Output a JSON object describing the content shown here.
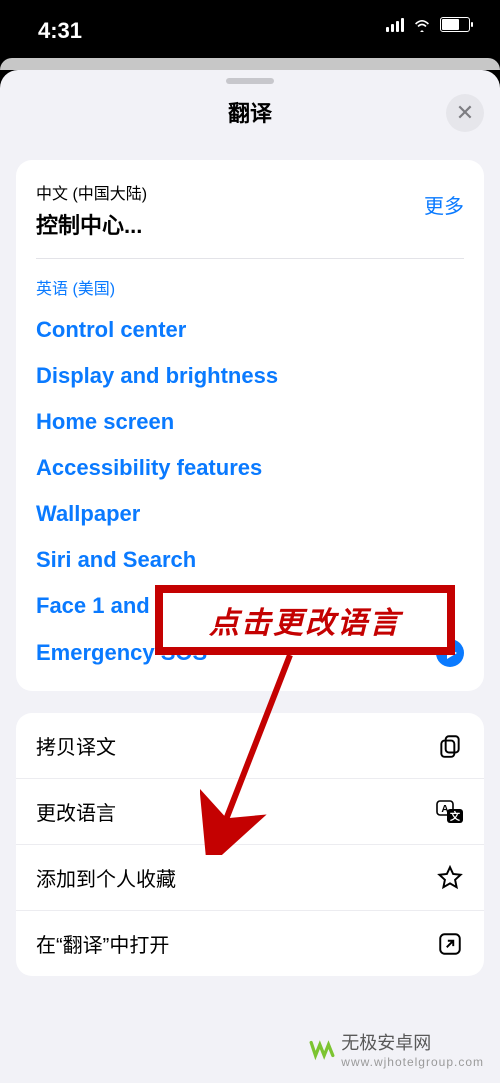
{
  "status": {
    "time": "4:31"
  },
  "sheet": {
    "title": "翻译",
    "more": "更多"
  },
  "source": {
    "lang": "中文 (中国大陆)",
    "text": "控制中心..."
  },
  "target": {
    "lang": "英语 (美国)",
    "items": [
      "Control center",
      "Display and brightness",
      "Home screen",
      "Accessibility features",
      "Wallpaper",
      "Siri and Search",
      "Face 1 and password",
      "Emergency SOS"
    ]
  },
  "actions": {
    "copy": "拷贝译文",
    "changeLang": "更改语言",
    "addFav": "添加到个人收藏",
    "openIn": "在“翻译”中打开"
  },
  "annotation": {
    "callout": "点击更改语言"
  },
  "watermark": {
    "name": "无极安卓网",
    "url": "www.wjhotelgroup.com"
  }
}
